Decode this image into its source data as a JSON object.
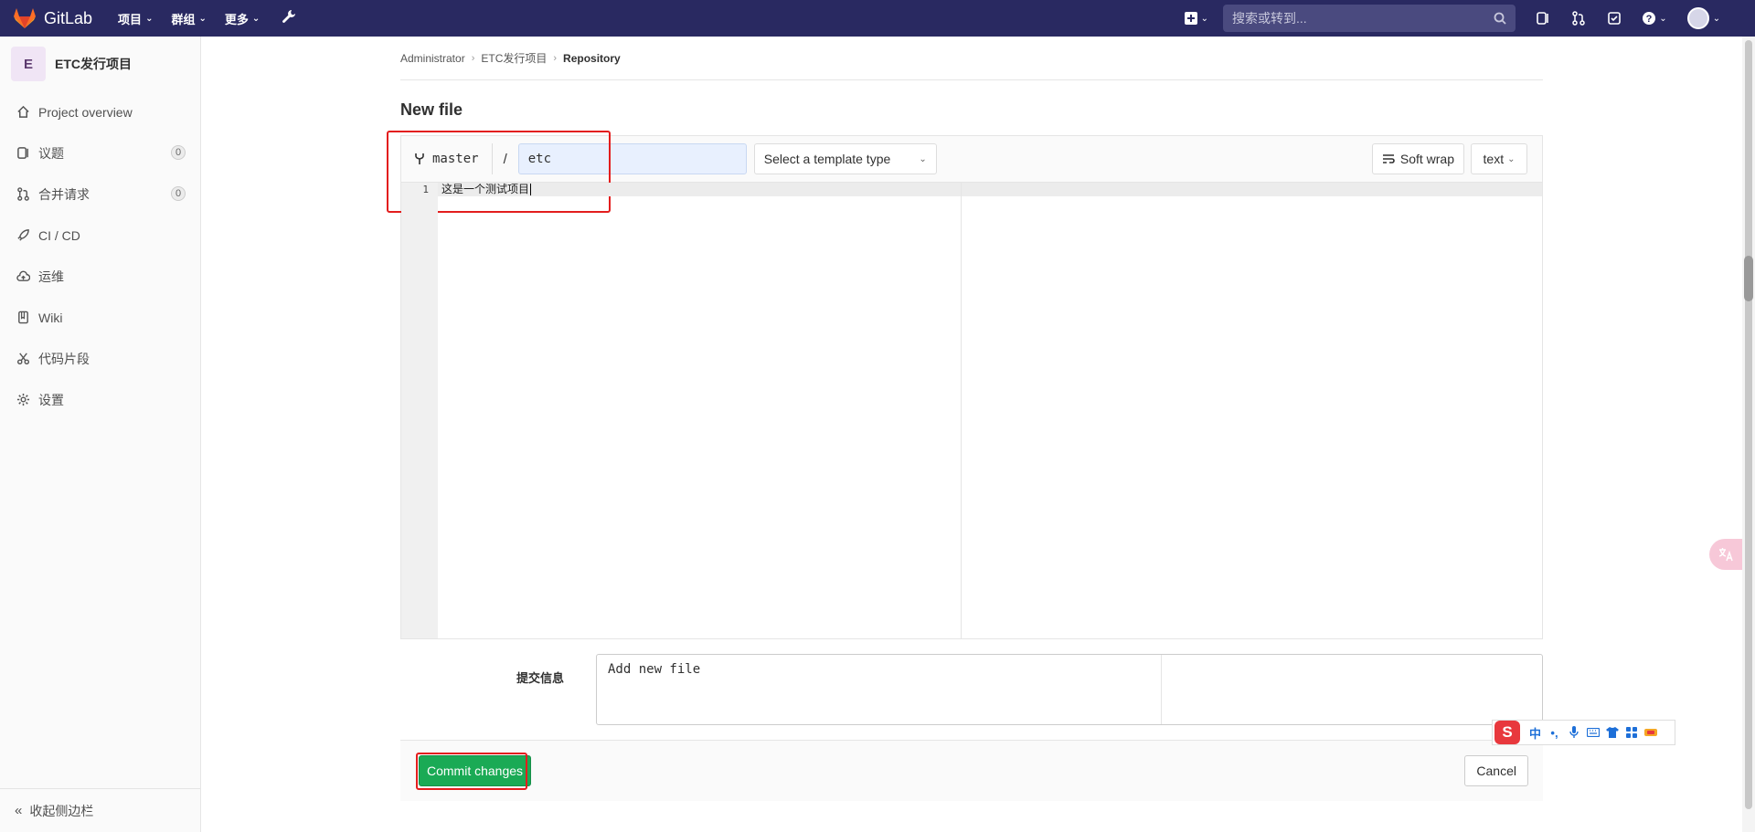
{
  "topbar": {
    "brand": "GitLab",
    "nav": [
      {
        "label": "项目"
      },
      {
        "label": "群组"
      },
      {
        "label": "更多"
      }
    ],
    "search_placeholder": "搜索或转到..."
  },
  "sidebar": {
    "project_initial": "E",
    "project_name": "ETC发行项目",
    "items": [
      {
        "label": "Project overview",
        "icon": "home-icon"
      },
      {
        "label": "议题",
        "icon": "issues-icon",
        "count": "0"
      },
      {
        "label": "合并请求",
        "icon": "merge-request-icon",
        "count": "0"
      },
      {
        "label": "CI / CD",
        "icon": "rocket-icon"
      },
      {
        "label": "运维",
        "icon": "cloud-icon"
      },
      {
        "label": "Wiki",
        "icon": "book-icon"
      },
      {
        "label": "代码片段",
        "icon": "scissors-icon"
      },
      {
        "label": "设置",
        "icon": "gear-icon"
      }
    ],
    "collapse_label": "收起侧边栏"
  },
  "breadcrumb": [
    "Administrator",
    "ETC发行项目",
    "Repository"
  ],
  "page_title": "New file",
  "editor": {
    "branch": "master",
    "separator": "/",
    "file_name": "etc",
    "template_placeholder": "Select a template type",
    "soft_wrap_label": "Soft wrap",
    "language": "text",
    "lines": [
      {
        "number": "1",
        "text": "这是一个测试项目"
      }
    ]
  },
  "commit": {
    "label": "提交信息",
    "message": "Add new file",
    "commit_button": "Commit changes",
    "cancel_button": "Cancel"
  },
  "ime": {
    "logo": "S",
    "mode": "中",
    "punct": "•,"
  },
  "colors": {
    "topbar": "#292961",
    "commit_green": "#1aaa55",
    "highlight_red": "#e31d1d"
  }
}
